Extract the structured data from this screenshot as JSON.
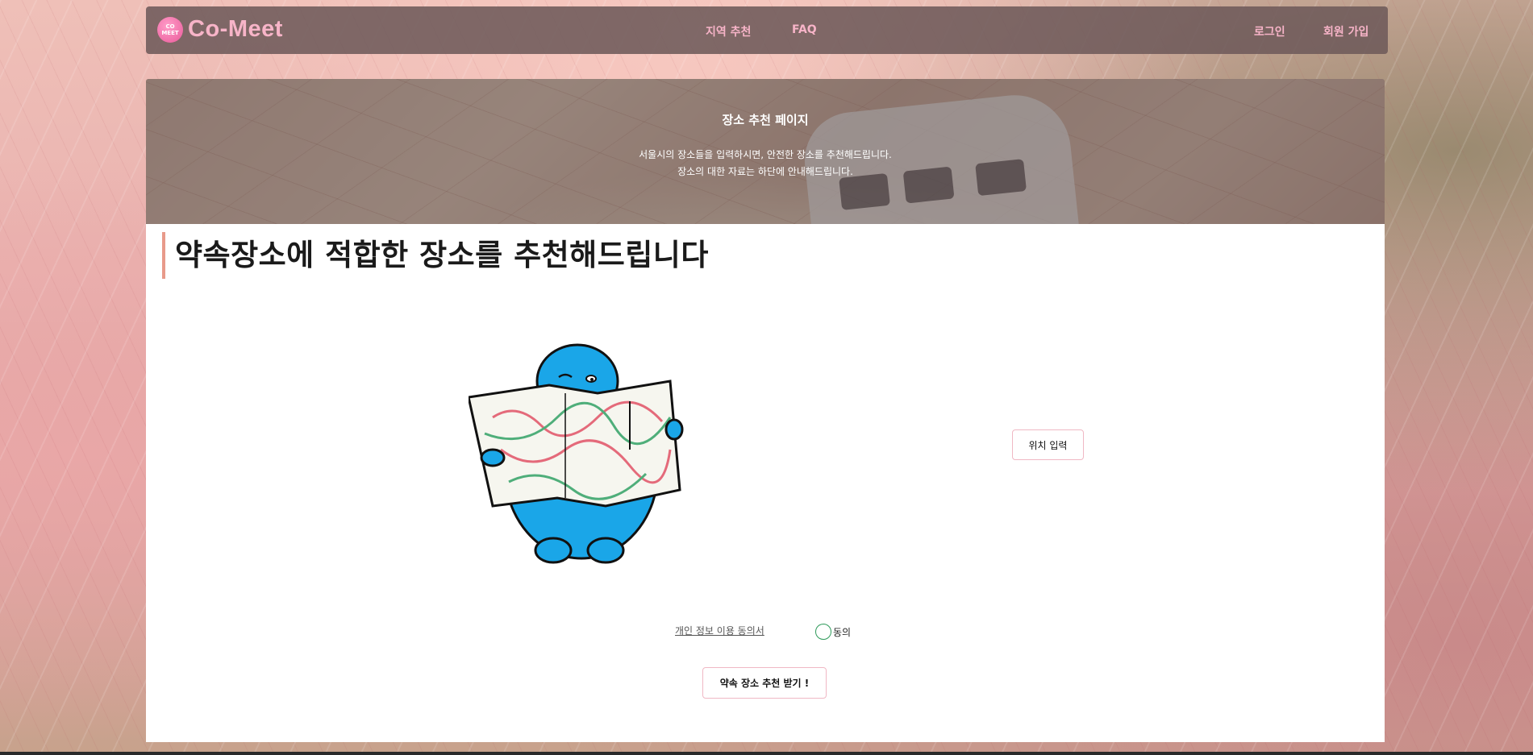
{
  "brand": {
    "logo_line1": "CO",
    "logo_line2": "MEET",
    "name": "Co-Meet"
  },
  "nav": {
    "links": [
      {
        "label": "지역 추천"
      },
      {
        "label": "FAQ"
      }
    ],
    "auth": [
      {
        "label": "로그인"
      },
      {
        "label": "회원 가입"
      }
    ]
  },
  "hero": {
    "title": "장소 추천 페이지",
    "desc_line1": "서울시의 장소들을 입력하시면, 안전한 장소를 추천해드립니다.",
    "desc_line2": "장소의 대한 자료는 하단에 안내해드립니다."
  },
  "main": {
    "heading": "약속장소에 적합한 장소를 추천해드립니다",
    "location_button": "위치 입력",
    "privacy_link": "개인 정보 이용 동의서",
    "agree_label": "동의",
    "submit_button": "약속 장소 추천 받기 !"
  },
  "colors": {
    "accent_pink": "#f7b4c8",
    "heading_border": "#e89a8a",
    "radio_green": "#2e9a5a",
    "mascot_blue": "#1aa6e8"
  }
}
